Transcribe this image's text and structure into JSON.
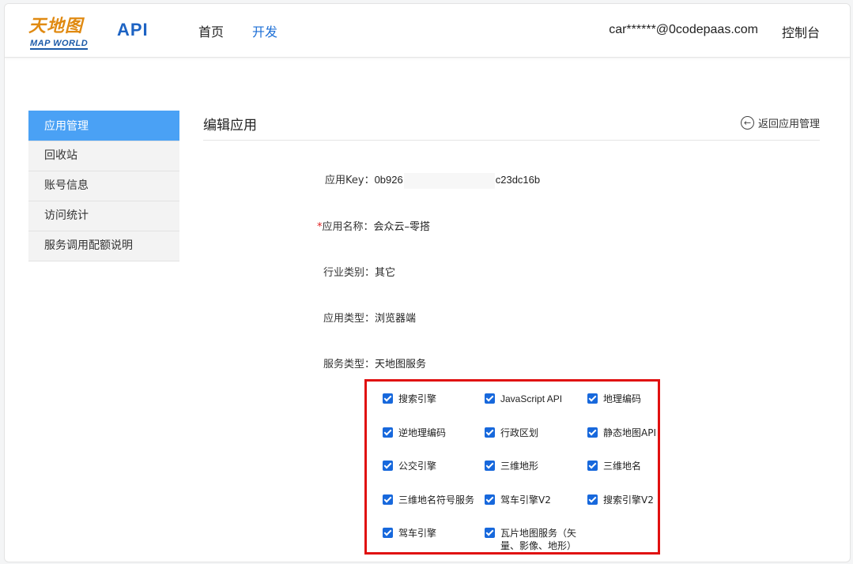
{
  "header": {
    "logo_cn": "天地图",
    "logo_en": "MAP WORLD",
    "logo_api": "API",
    "nav": [
      {
        "label": "首页",
        "active": false
      },
      {
        "label": "开发",
        "active": true
      }
    ],
    "user_email": "car******@0codepaas.com",
    "console_label": "控制台"
  },
  "sidebar": {
    "items": [
      {
        "label": "应用管理",
        "active": true
      },
      {
        "label": "回收站",
        "active": false
      },
      {
        "label": "账号信息",
        "active": false
      },
      {
        "label": "访问统计",
        "active": false
      },
      {
        "label": "服务调用配额说明",
        "active": false
      }
    ]
  },
  "main": {
    "title": "编辑应用",
    "back_label": "返回应用管理",
    "fields": {
      "key_label": "应用Key：",
      "key_prefix": "0b926",
      "key_suffix": "c23dc16b",
      "name_required": "*",
      "name_label": "应用名称：",
      "name_value": "会众云–零搭",
      "industry_label": "行业类别：",
      "industry_value": "其它",
      "type_label": "应用类型：",
      "type_value": "浏览器端",
      "service_label": "服务类型：",
      "service_value": "天地图服务"
    },
    "services": [
      {
        "label": "搜索引擎",
        "checked": true
      },
      {
        "label": "JavaScript API",
        "checked": true
      },
      {
        "label": "地理编码",
        "checked": true
      },
      {
        "label": "逆地理编码",
        "checked": true
      },
      {
        "label": "行政区划",
        "checked": true
      },
      {
        "label": "静态地图API",
        "checked": true
      },
      {
        "label": "公交引擎",
        "checked": true
      },
      {
        "label": "三维地形",
        "checked": true
      },
      {
        "label": "三维地名",
        "checked": true
      },
      {
        "label": "三维地名符号服务",
        "checked": true
      },
      {
        "label": "驾车引擎V2",
        "checked": true
      },
      {
        "label": "搜索引擎V2",
        "checked": true
      },
      {
        "label": "驾车引擎",
        "checked": true
      },
      {
        "label": "瓦片地图服务（矢量、影像、地形）",
        "checked": true
      }
    ],
    "accent_color": "#4aa1f5",
    "highlight_color": "#e01010"
  }
}
